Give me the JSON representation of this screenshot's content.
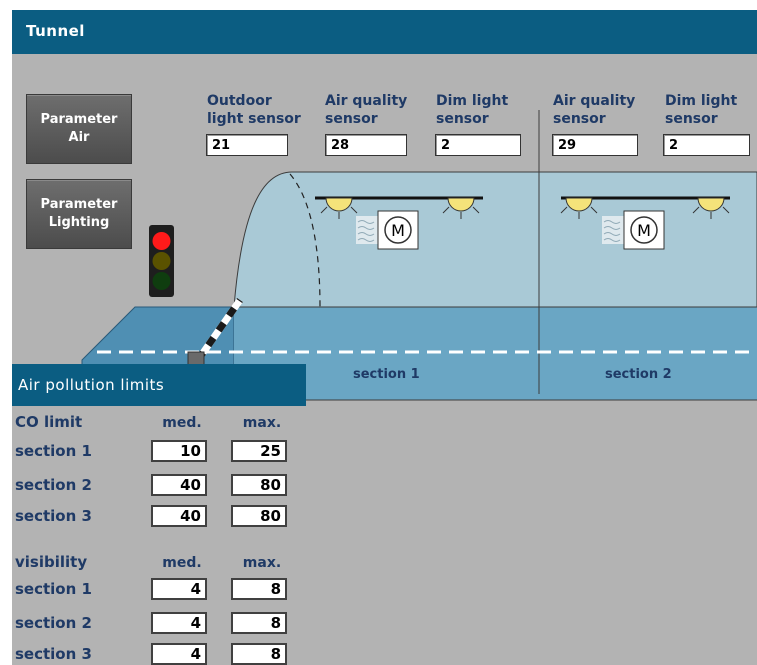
{
  "app": {
    "title": "Tunnel"
  },
  "buttons": {
    "param_air": "Parameter Air",
    "param_lighting": "Parameter Lighting"
  },
  "sensors": [
    {
      "label_l1": "Outdoor",
      "label_l2": "light sensor",
      "value": "21"
    },
    {
      "label_l1": "Air quality",
      "label_l2": "sensor",
      "value": "28"
    },
    {
      "label_l1": "Dim light",
      "label_l2": "sensor",
      "value": "2"
    },
    {
      "label_l1": "Air quality",
      "label_l2": "sensor",
      "value": "29"
    },
    {
      "label_l1": "Dim light",
      "label_l2": "sensor",
      "value": "2"
    }
  ],
  "tunnel": {
    "section1": "section 1",
    "section2": "section 2"
  },
  "traffic_light": {
    "state": "red",
    "colors": {
      "red": "#ff1a1a",
      "amber_off": "#5a5200",
      "green_off": "#0f3d0f"
    }
  },
  "panel": {
    "title": "Air pollution limits",
    "co": {
      "header": "CO limit",
      "med_label": "med.",
      "max_label": "max.",
      "rows": [
        {
          "label": "section 1",
          "med": "10",
          "max": "25"
        },
        {
          "label": "section 2",
          "med": "40",
          "max": "80"
        },
        {
          "label": "section 3",
          "med": "40",
          "max": "80"
        }
      ]
    },
    "visibility": {
      "header": "visibility",
      "med_label": "med.",
      "max_label": "max.",
      "rows": [
        {
          "label": "section 1",
          "med": "4",
          "max": "8"
        },
        {
          "label": "section 2",
          "med": "4",
          "max": "8"
        },
        {
          "label": "section 3",
          "med": "4",
          "max": "8"
        }
      ]
    }
  },
  "colors": {
    "title_bar": "#0b5d82",
    "background": "#b3b3b3",
    "label_text": "#1f3a66",
    "tunnel_water": "#5f9dbd",
    "tunnel_dome": "#a9c9d6"
  }
}
